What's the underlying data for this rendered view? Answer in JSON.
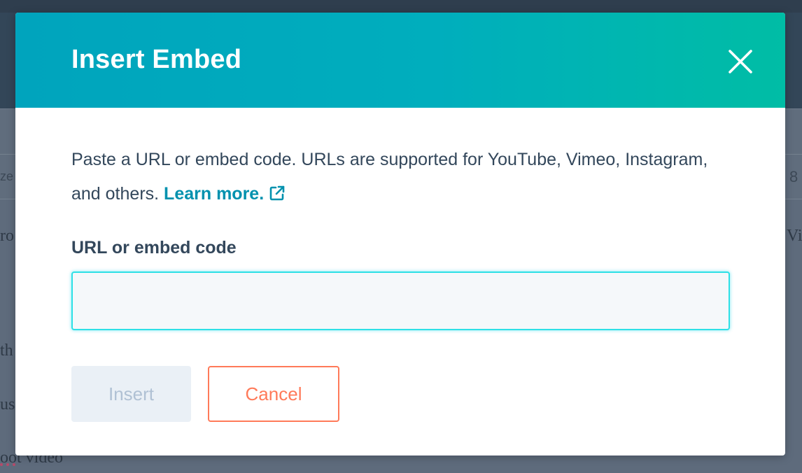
{
  "background": {
    "fragments": [
      "ze",
      "ro",
      "th",
      "us",
      "oot video"
    ],
    "right_fragments": [
      "8",
      "Vi"
    ]
  },
  "modal": {
    "title": "Insert Embed",
    "close_icon": "close-icon",
    "description_text": "Paste a URL or embed code. URLs are supported for YouTube, Vimeo, Instagram, and others.",
    "learn_more_label": "Learn more.",
    "external_link_icon": "external-link-icon",
    "field_label": "URL or embed code",
    "input_value": "",
    "input_placeholder": "",
    "insert_label": "Insert",
    "cancel_label": "Cancel"
  },
  "colors": {
    "header_gradient_start": "#00a4bd",
    "header_gradient_end": "#00bda5",
    "link": "#0091ae",
    "cancel_accent": "#ff7a59",
    "input_focus": "#2ee0e6",
    "text": "#33475b"
  }
}
